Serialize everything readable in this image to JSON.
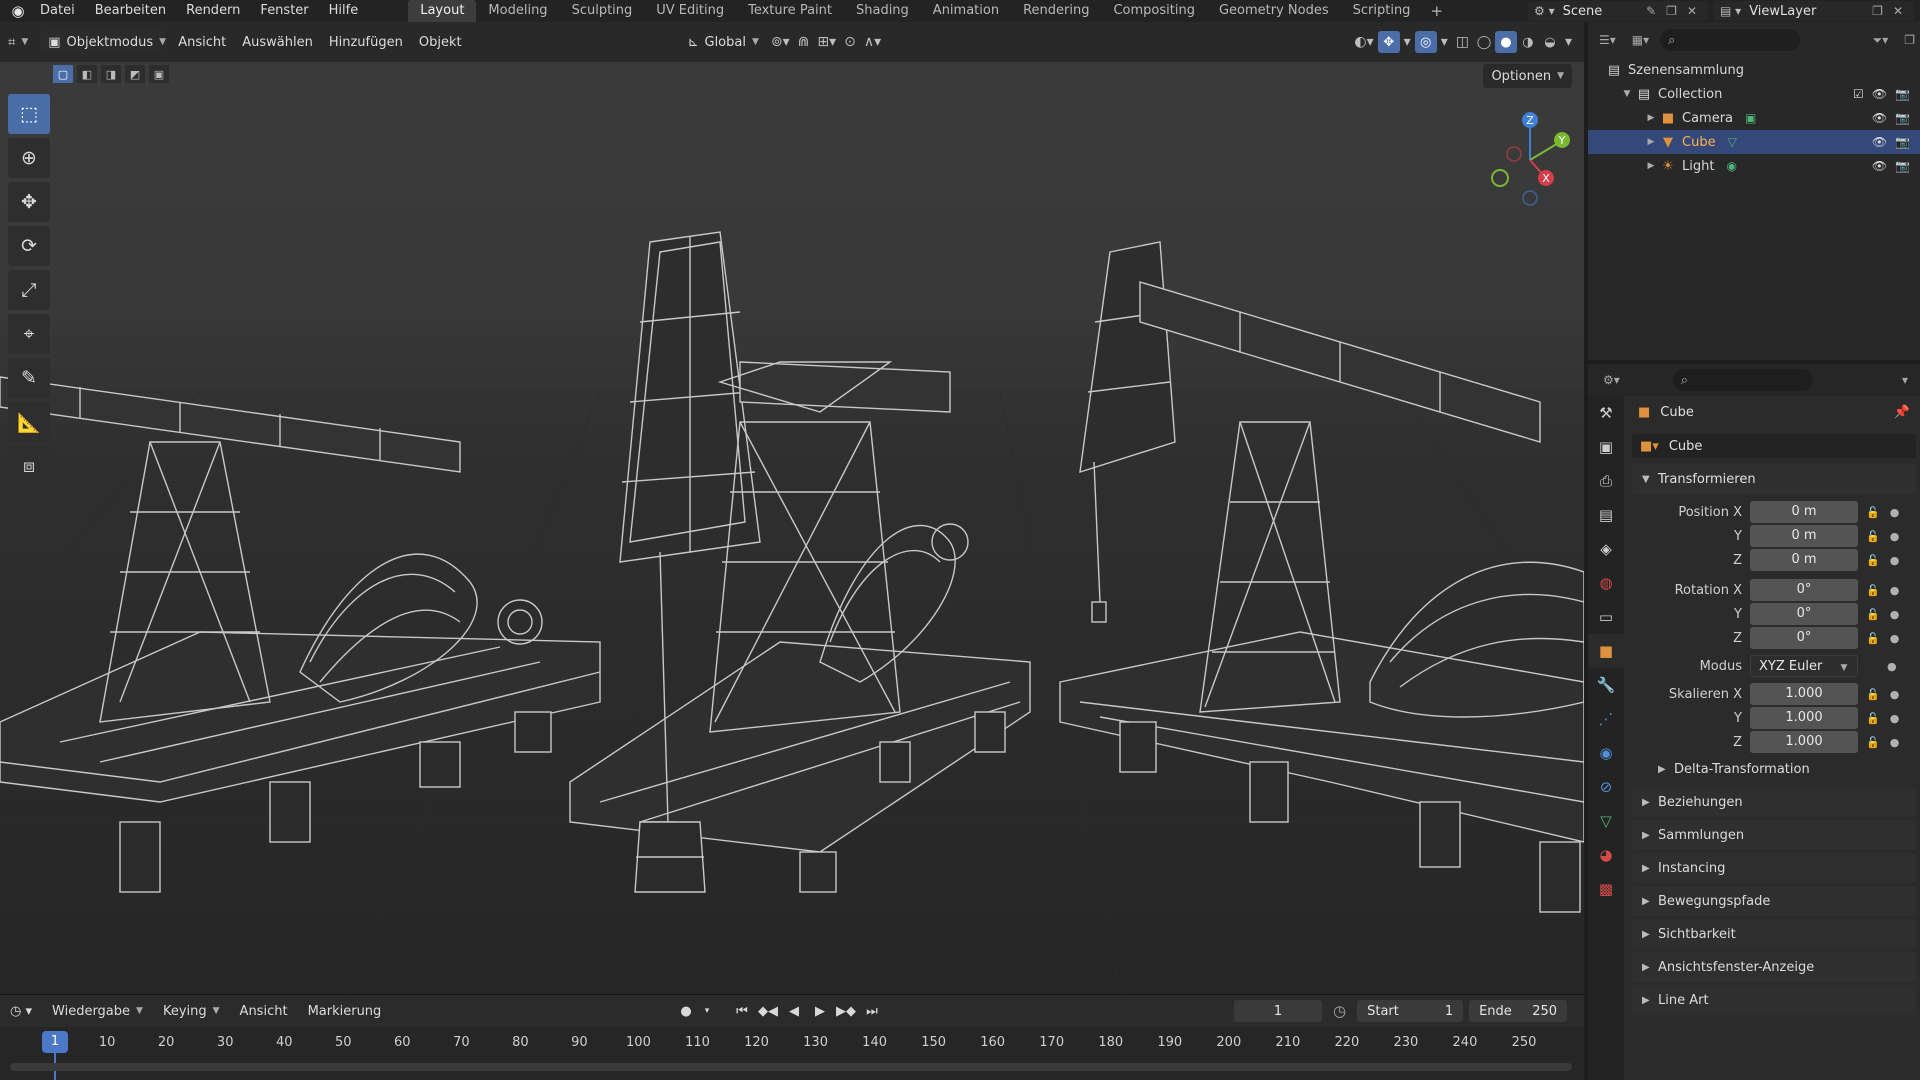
{
  "menubar": {
    "items": [
      "Datei",
      "Bearbeiten",
      "Rendern",
      "Fenster",
      "Hilfe"
    ],
    "workspaces": [
      "Layout",
      "Modeling",
      "Sculpting",
      "UV Editing",
      "Texture Paint",
      "Shading",
      "Animation",
      "Rendering",
      "Compositing",
      "Geometry Nodes",
      "Scripting"
    ],
    "active_workspace": "Layout",
    "scene": "Scene",
    "view_layer": "ViewLayer"
  },
  "viewport": {
    "mode": "Objektmodus",
    "menu": [
      "Ansicht",
      "Auswählen",
      "Hinzufügen",
      "Objekt"
    ],
    "orientation": "Global",
    "options": "Optionen",
    "gizmo_axes": [
      "X",
      "Y",
      "Z"
    ],
    "tools": [
      "select-box",
      "cursor",
      "move",
      "rotate",
      "scale",
      "transform",
      "annotate",
      "measure",
      "add-cube"
    ],
    "active_tool": "select-box"
  },
  "timeline": {
    "menu": [
      "Wiedergabe",
      "Keying",
      "Ansicht",
      "Markierung"
    ],
    "current_frame": "1",
    "start_label": "Start",
    "start_value": "1",
    "end_label": "Ende",
    "end_value": "250",
    "ruler_labels": [
      "10",
      "20",
      "30",
      "40",
      "50",
      "60",
      "70",
      "80",
      "90",
      "100",
      "110",
      "120",
      "130",
      "140",
      "150",
      "160",
      "170",
      "180",
      "190",
      "200",
      "210",
      "220",
      "230",
      "240",
      "250"
    ]
  },
  "outliner": {
    "root": "Szenensammlung",
    "collection": "Collection",
    "items": [
      {
        "name": "Camera",
        "icon": "camera-icon",
        "color": "#e0913d",
        "extra_color": "#4fb37a"
      },
      {
        "name": "Cube",
        "icon": "mesh-icon",
        "color": "#e0913d",
        "extra_color": "#4fb37a"
      },
      {
        "name": "Light",
        "icon": "light-icon",
        "color": "#e0913d",
        "extra_color": "#4fb37a"
      }
    ],
    "selected": "Cube"
  },
  "properties": {
    "object_name": "Cube",
    "object_box": "Cube",
    "transform_title": "Transformieren",
    "position": {
      "label_x": "Position X",
      "label_y": "Y",
      "label_z": "Z",
      "x": "0 m",
      "y": "0 m",
      "z": "0 m"
    },
    "rotation": {
      "label_x": "Rotation X",
      "label_y": "Y",
      "label_z": "Z",
      "x": "0°",
      "y": "0°",
      "z": "0°"
    },
    "mode": {
      "label": "Modus",
      "value": "XYZ Euler"
    },
    "scale": {
      "label_x": "Skalieren X",
      "label_y": "Y",
      "label_z": "Z",
      "x": "1.000",
      "y": "1.000",
      "z": "1.000"
    },
    "delta": "Delta-Transformation",
    "panels": [
      "Beziehungen",
      "Sammlungen",
      "Instancing",
      "Bewegungspfade",
      "Sichtbarkeit",
      "Ansichtsfenster-Anzeige",
      "Line Art"
    ]
  },
  "colors": {
    "accent": "#4b6ea8",
    "selection": "#34497a",
    "frame_marker": "#4b79c8",
    "axis_x": "#d23f48",
    "axis_y": "#7ab834",
    "axis_z": "#3f7fd6"
  }
}
